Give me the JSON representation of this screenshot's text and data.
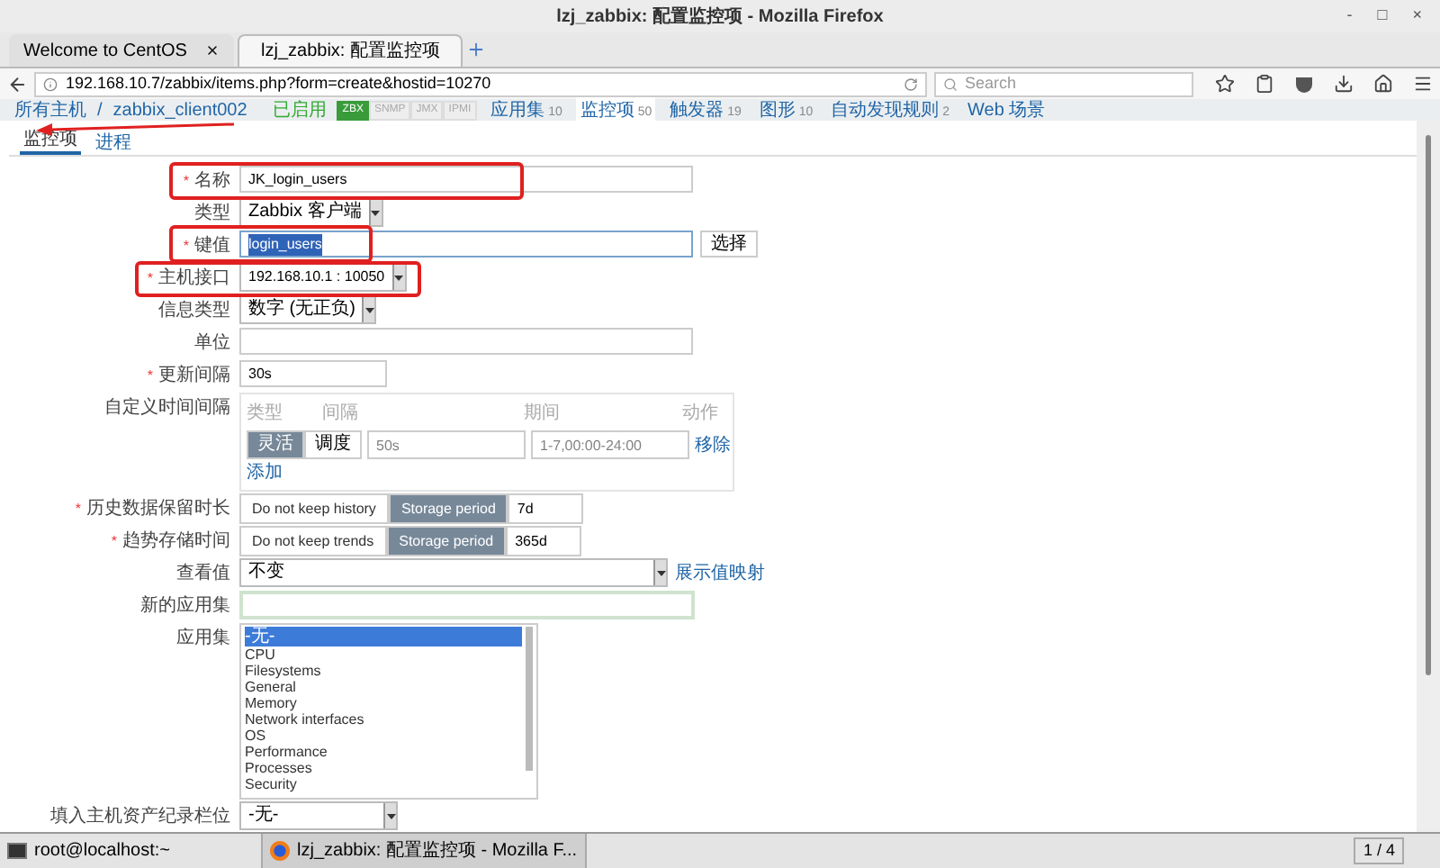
{
  "window": {
    "title": "lzj_zabbix: 配置监控项 - Mozilla Firefox",
    "controls": [
      "-",
      "□",
      "×"
    ]
  },
  "browser_tabs": [
    {
      "label": "Welcome to CentOS",
      "selected": false
    },
    {
      "label": "lzj_zabbix: 配置监控项",
      "selected": true
    }
  ],
  "url": "192.168.10.7/zabbix/items.php?form=create&hostid=10270",
  "search": {
    "placeholder": "Search"
  },
  "breadcrumb": {
    "items": [
      "所有主机",
      "/",
      "zabbix_client002"
    ],
    "status": "已启用",
    "badges": [
      {
        "label": "ZBX",
        "active": true
      },
      {
        "label": "SNMP",
        "active": false
      },
      {
        "label": "JMX",
        "active": false
      },
      {
        "label": "IPMI",
        "active": false
      }
    ],
    "links": [
      {
        "label": "应用集",
        "count": "10",
        "selected": false
      },
      {
        "label": "监控项",
        "count": "50",
        "selected": true
      },
      {
        "label": "触发器",
        "count": "19",
        "selected": false
      },
      {
        "label": "图形",
        "count": "10",
        "selected": false
      },
      {
        "label": "自动发现规则",
        "count": "2",
        "selected": false
      },
      {
        "label": "Web 场景",
        "selected": false
      }
    ]
  },
  "page_tabs": [
    {
      "label": "监控项",
      "selected": true
    },
    {
      "label": "进程",
      "selected": false
    }
  ],
  "form": {
    "name": {
      "label": "名称",
      "mark": "*",
      "value": "JK_login_users"
    },
    "type": {
      "label": "类型",
      "value": "Zabbix 客户端"
    },
    "key": {
      "label": "键值",
      "mark": "*",
      "value": "login_users",
      "button": "选择"
    },
    "interface": {
      "label": "主机接口",
      "mark": "*",
      "value": "192.168.10.1 : 10050"
    },
    "info_type": {
      "label": "信息类型",
      "value": "数字 (无正负)"
    },
    "units": {
      "label": "单位"
    },
    "interval": {
      "label": "更新间隔",
      "mark": "*",
      "value": "30s"
    },
    "custom": {
      "label": "自定义时间间隔",
      "headers": [
        "类型",
        "间隔",
        "期间",
        "动作"
      ],
      "modes": [
        {
          "label": "灵活",
          "selected": true
        },
        {
          "label": "调度",
          "selected": false
        }
      ],
      "delay": {
        "placeholder": "50s"
      },
      "period": {
        "placeholder": "1-7,00:00-24:00"
      },
      "remove": "移除",
      "add": "添加"
    },
    "history": {
      "label": "历史数据保留时长",
      "mark": "*",
      "options": [
        {
          "label": "Do not keep history",
          "selected": false
        },
        {
          "label": "Storage period",
          "selected": true
        }
      ],
      "value": "7d"
    },
    "trends": {
      "label": "趋势存储时间",
      "mark": "*",
      "options": [
        {
          "label": "Do not keep trends",
          "selected": false
        },
        {
          "label": "Storage period",
          "selected": true
        }
      ],
      "value": "365d"
    },
    "valuemap": {
      "label": "查看值",
      "value": "不变",
      "link": "展示值映射"
    },
    "new_app": {
      "label": "新的应用集"
    },
    "apps": {
      "label": "应用集",
      "items": [
        {
          "label": "-无-",
          "selected": true
        },
        {
          "label": "CPU",
          "selected": false
        },
        {
          "label": "Filesystems",
          "selected": false
        },
        {
          "label": "General",
          "selected": false
        },
        {
          "label": "Memory",
          "selected": false
        },
        {
          "label": "Network interfaces",
          "selected": false
        },
        {
          "label": "OS",
          "selected": false
        },
        {
          "label": "Performance",
          "selected": false
        },
        {
          "label": "Processes",
          "selected": false
        },
        {
          "label": "Security",
          "selected": false
        }
      ]
    },
    "inventory": {
      "label": "填入主机资产纪录栏位",
      "value": "-无-"
    }
  },
  "taskbar": {
    "items": [
      {
        "label": "root@localhost:~",
        "kind": "terminal",
        "selected": false
      },
      {
        "label": "lzj_zabbix: 配置监控项 - Mozilla F...",
        "kind": "firefox",
        "selected": true
      }
    ],
    "pager": "1 / 4"
  }
}
